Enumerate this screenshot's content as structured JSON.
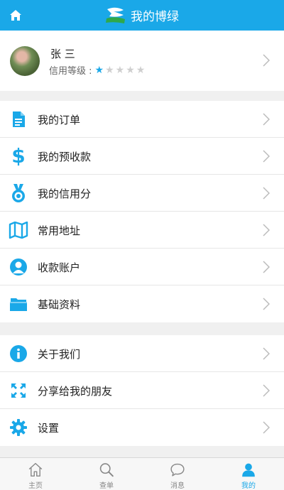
{
  "header": {
    "title": "我的博绿",
    "home_icon": "home-icon",
    "logo_icon": "bolu-logo-icon",
    "bg_color": "#1aa8e8"
  },
  "profile": {
    "name": "张 三",
    "level_label": "信用等级 :",
    "rating": 1,
    "rating_max": 5
  },
  "menu_group1": [
    {
      "label": "我的订单",
      "icon": "document-icon"
    },
    {
      "label": "我的预收款",
      "icon": "dollar-icon"
    },
    {
      "label": "我的信用分",
      "icon": "medal-icon"
    },
    {
      "label": "常用地址",
      "icon": "map-icon"
    },
    {
      "label": "收款账户",
      "icon": "account-icon"
    },
    {
      "label": "基础资料",
      "icon": "folder-icon"
    }
  ],
  "menu_group2": [
    {
      "label": "关于我们",
      "icon": "info-icon"
    },
    {
      "label": "分享给我的朋友",
      "icon": "share-icon"
    },
    {
      "label": "设置",
      "icon": "gear-icon"
    }
  ],
  "tabbar": [
    {
      "label": "主页",
      "icon": "home-outline-icon",
      "active": false
    },
    {
      "label": "查单",
      "icon": "search-icon",
      "active": false
    },
    {
      "label": "消息",
      "icon": "chat-icon",
      "active": false
    },
    {
      "label": "我的",
      "icon": "person-icon",
      "active": true
    }
  ],
  "colors": {
    "accent": "#1aa8e8",
    "separator": "#f0f0f0",
    "star_off": "#cfcfcf"
  }
}
